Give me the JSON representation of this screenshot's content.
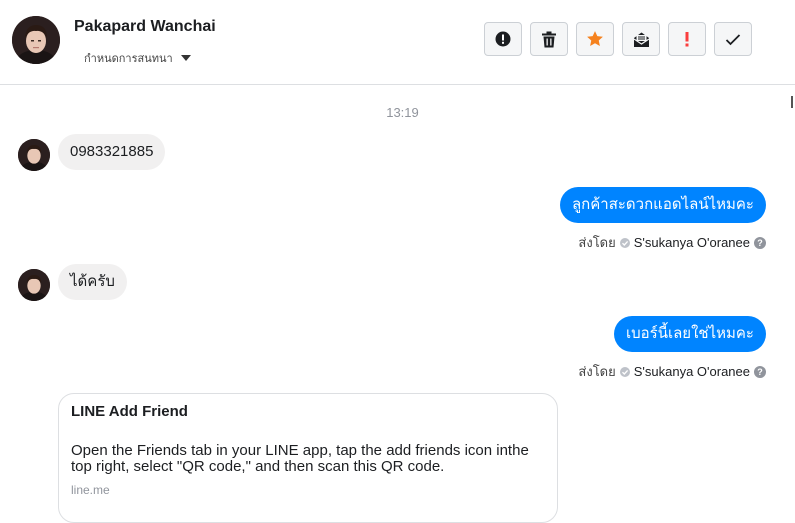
{
  "header": {
    "contact_name": "Pakapard Wanchai",
    "status_dropdown": "กำหนดการสนทนา",
    "toolbar": [
      {
        "name": "spam-button",
        "icon": "alert-circle-icon"
      },
      {
        "name": "delete-button",
        "icon": "trash-icon"
      },
      {
        "name": "star-button",
        "icon": "star-icon",
        "color": "#f5821f"
      },
      {
        "name": "unread-button",
        "icon": "envelope-icon"
      },
      {
        "name": "priority-button",
        "icon": "exclamation-icon",
        "color": "#fa3e3e"
      },
      {
        "name": "done-button",
        "icon": "check-icon"
      }
    ]
  },
  "conversation": {
    "timestamp": "13:19",
    "messages": [
      {
        "direction": "in",
        "text": "0983321885"
      },
      {
        "direction": "out",
        "text": "ลูกค้าสะดวกแอดไลน์ไหมคะ",
        "sent_by_label": "ส่งโดย",
        "sender": "S'sukanya O'oranee"
      },
      {
        "direction": "in",
        "text": "ได้ครับ"
      },
      {
        "direction": "out",
        "text": "เบอร์นี้เลยใช่ไหมคะ",
        "sent_by_label": "ส่งโดย",
        "sender": "S'sukanya O'oranee"
      }
    ],
    "link_card": {
      "title": "LINE Add Friend",
      "description": "Open the Friends tab in your LINE app, tap the add friends icon inthe top right, select \"QR code,\" and then scan this QR code.",
      "domain": "line.me"
    }
  },
  "colors": {
    "outgoing_bubble": "#0084ff",
    "incoming_bubble": "#f1f0f0",
    "star": "#f5821f",
    "priority": "#fa3e3e"
  }
}
